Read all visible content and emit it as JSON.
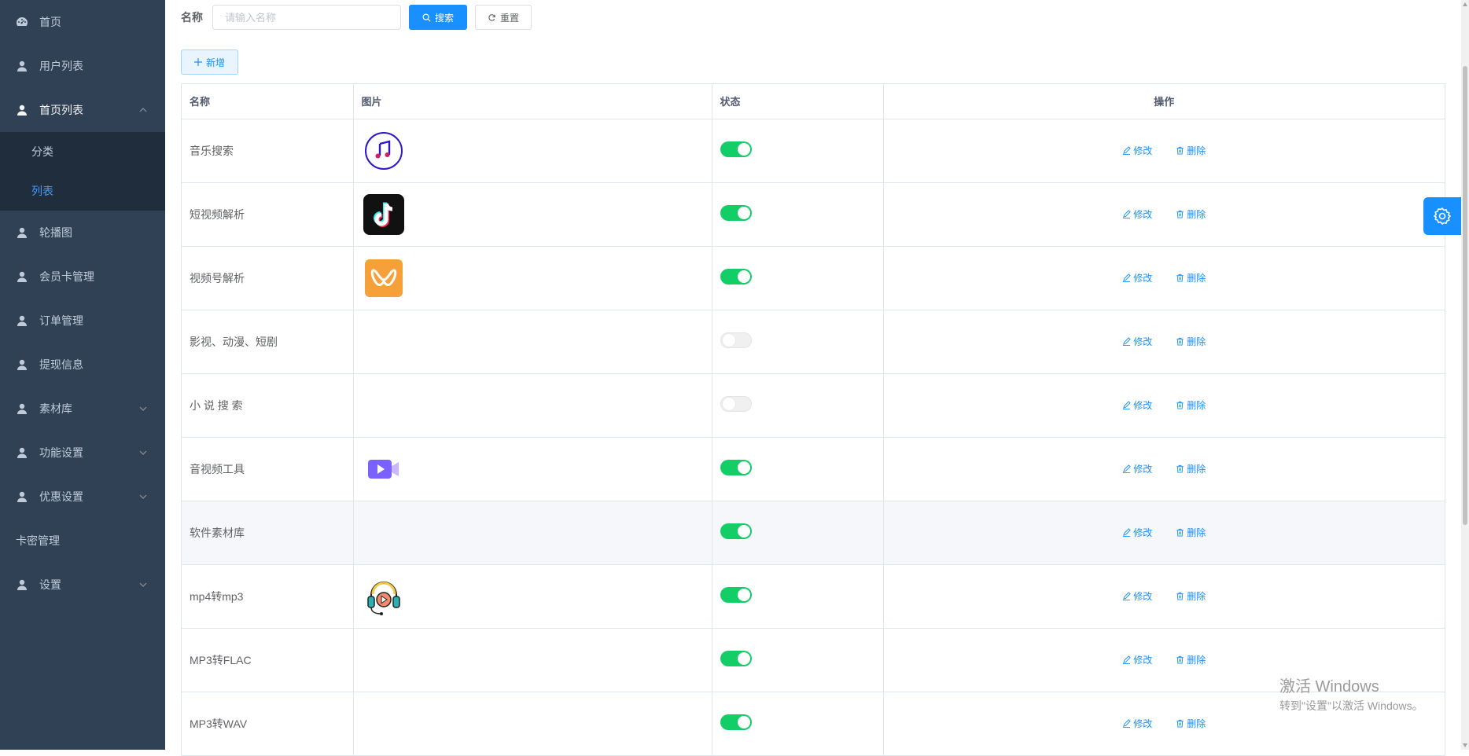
{
  "sidebar": {
    "items": [
      {
        "label": "首页",
        "icon": "dashboard-icon"
      },
      {
        "label": "用户列表",
        "icon": "user-icon"
      },
      {
        "label": "首页列表",
        "icon": "user-icon",
        "expanded": true,
        "children": [
          {
            "label": "分类"
          },
          {
            "label": "列表",
            "active": true
          }
        ]
      },
      {
        "label": "轮播图",
        "icon": "user-icon"
      },
      {
        "label": "会员卡管理",
        "icon": "user-icon"
      },
      {
        "label": "订单管理",
        "icon": "user-icon"
      },
      {
        "label": "提现信息",
        "icon": "user-icon"
      },
      {
        "label": "素材库",
        "icon": "user-icon",
        "collapsible": true
      },
      {
        "label": "功能设置",
        "icon": "user-icon",
        "collapsible": true
      },
      {
        "label": "优惠设置",
        "icon": "user-icon",
        "collapsible": true
      },
      {
        "label": "卡密管理"
      },
      {
        "label": "设置",
        "icon": "user-icon",
        "collapsible": true
      }
    ]
  },
  "search": {
    "label": "名称",
    "placeholder": "请输入名称",
    "search_btn": "搜索",
    "reset_btn": "重置"
  },
  "toolbar": {
    "add_btn": "新增"
  },
  "table": {
    "headers": [
      "名称",
      "图片",
      "状态",
      "操作"
    ],
    "edit_label": "修改",
    "delete_label": "删除",
    "rows": [
      {
        "name": "音乐搜索",
        "image": "music-note-icon",
        "enabled": true
      },
      {
        "name": "短视频解析",
        "image": "tiktok-logo-icon",
        "enabled": true
      },
      {
        "name": "视频号解析",
        "image": "channels-logo-icon",
        "enabled": true
      },
      {
        "name": "影视、动漫、短剧",
        "image": "",
        "enabled": false
      },
      {
        "name": "小 说 搜 索",
        "image": "",
        "enabled": false
      },
      {
        "name": "音视频工具",
        "image": "video-camera-icon",
        "enabled": true
      },
      {
        "name": "软件素材库",
        "image": "",
        "enabled": true
      },
      {
        "name": "mp4转mp3",
        "image": "headphones-play-icon",
        "enabled": true
      },
      {
        "name": "MP3转FLAC",
        "image": "",
        "enabled": true
      },
      {
        "name": "MP3转WAV",
        "image": "",
        "enabled": true
      }
    ]
  },
  "watermark": {
    "line1": "激活 Windows",
    "line2": "转到\"设置\"以激活 Windows。"
  },
  "colors": {
    "sidebar_bg": "#304156",
    "submenu_bg": "#1f2d3d",
    "primary": "#1890ff",
    "switch_on": "#13ce66"
  }
}
